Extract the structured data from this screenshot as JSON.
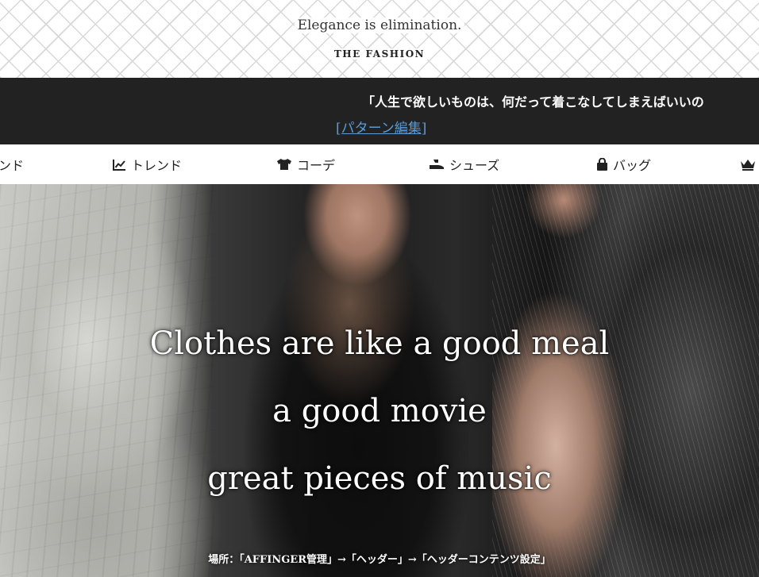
{
  "header": {
    "tagline": "Elegance is elimination.",
    "site_title": "THE FASHION"
  },
  "infobar": {
    "quote": "「人生で欲しいものは、何だって着こなしてしまえばいいの",
    "edit_link": "[パターン編集]"
  },
  "nav": {
    "items": [
      {
        "label": "ンド",
        "icon": "none"
      },
      {
        "label": "トレンド",
        "icon": "trend-chart-icon"
      },
      {
        "label": "コーデ",
        "icon": "tshirt-icon"
      },
      {
        "label": "シューズ",
        "icon": "shoe-icon"
      },
      {
        "label": "バッグ",
        "icon": "bag-icon"
      },
      {
        "label": "",
        "icon": "crown-icon"
      }
    ]
  },
  "hero": {
    "line1": "Clothes are like a good meal",
    "line2": "a good movie",
    "line3": "great pieces of music",
    "footer": "場所：「AFFINGER管理」→「ヘッダー」→「ヘッダーコンテンツ設定」"
  },
  "colors": {
    "infobar_bg": "#222222",
    "link": "#5b9bd5"
  }
}
